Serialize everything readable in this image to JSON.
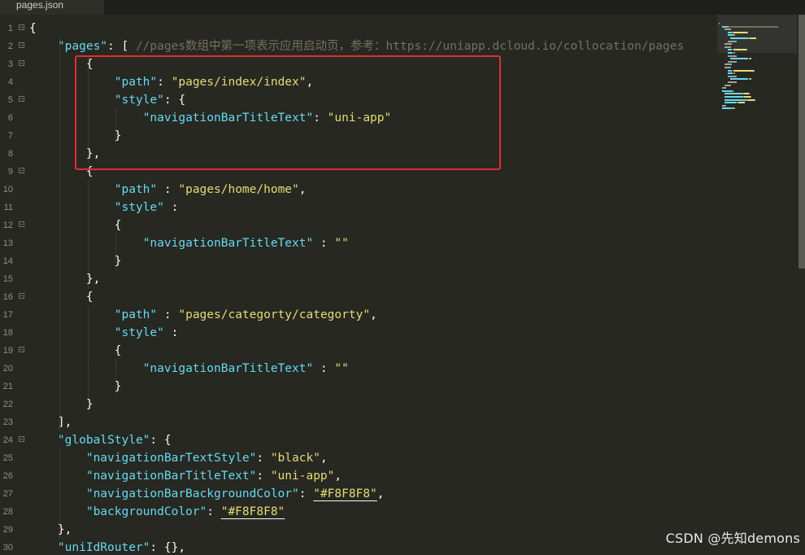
{
  "tab": {
    "filename": "pages.json"
  },
  "watermark": "CSDN @先知demons",
  "colors": {
    "background": "#272822",
    "string": "#e6db74",
    "key": "#66d9ef",
    "comment": "#75715e",
    "highlight_box": "#e0302a"
  },
  "lines": [
    {
      "n": "1",
      "fold": true,
      "tokens": [
        [
          "p",
          "{"
        ]
      ]
    },
    {
      "n": "2",
      "fold": true,
      "tokens": [
        [
          "p",
          "    "
        ],
        [
          "k",
          "\"pages\""
        ],
        [
          "p",
          ": [ "
        ],
        [
          "c",
          "//pages数组中第一项表示应用启动页，参考：https://uniapp.dcloud.io/collocation/pages"
        ]
      ]
    },
    {
      "n": "3",
      "fold": true,
      "tokens": [
        [
          "p",
          "        {"
        ]
      ]
    },
    {
      "n": "4",
      "fold": false,
      "tokens": [
        [
          "p",
          "            "
        ],
        [
          "k",
          "\"path\""
        ],
        [
          "p",
          ": "
        ],
        [
          "s",
          "\"pages/index/index\""
        ],
        [
          "p",
          ","
        ]
      ]
    },
    {
      "n": "5",
      "fold": true,
      "tokens": [
        [
          "p",
          "            "
        ],
        [
          "k",
          "\"style\""
        ],
        [
          "p",
          ": {"
        ]
      ]
    },
    {
      "n": "6",
      "fold": false,
      "tokens": [
        [
          "p",
          "                "
        ],
        [
          "k",
          "\"navigationBarTitleText\""
        ],
        [
          "p",
          ": "
        ],
        [
          "s",
          "\"uni-app\""
        ]
      ]
    },
    {
      "n": "7",
      "fold": false,
      "tokens": [
        [
          "p",
          "            }"
        ]
      ]
    },
    {
      "n": "8",
      "fold": false,
      "tokens": [
        [
          "p",
          "        },"
        ]
      ]
    },
    {
      "n": "9",
      "fold": true,
      "tokens": [
        [
          "p",
          "        {"
        ]
      ]
    },
    {
      "n": "10",
      "fold": false,
      "tokens": [
        [
          "p",
          "            "
        ],
        [
          "k",
          "\"path\""
        ],
        [
          "p",
          " : "
        ],
        [
          "s",
          "\"pages/home/home\""
        ],
        [
          "p",
          ","
        ]
      ]
    },
    {
      "n": "11",
      "fold": false,
      "tokens": [
        [
          "p",
          "            "
        ],
        [
          "k",
          "\"style\""
        ],
        [
          "p",
          " :"
        ]
      ]
    },
    {
      "n": "12",
      "fold": true,
      "tokens": [
        [
          "p",
          "            {"
        ]
      ]
    },
    {
      "n": "13",
      "fold": false,
      "tokens": [
        [
          "p",
          "                "
        ],
        [
          "k",
          "\"navigationBarTitleText\""
        ],
        [
          "p",
          " : "
        ],
        [
          "s",
          "\"\""
        ]
      ]
    },
    {
      "n": "14",
      "fold": false,
      "tokens": [
        [
          "p",
          "            }"
        ]
      ]
    },
    {
      "n": "15",
      "fold": false,
      "tokens": [
        [
          "p",
          "        },"
        ]
      ]
    },
    {
      "n": "16",
      "fold": true,
      "tokens": [
        [
          "p",
          "        {"
        ]
      ]
    },
    {
      "n": "17",
      "fold": false,
      "tokens": [
        [
          "p",
          "            "
        ],
        [
          "k",
          "\"path\""
        ],
        [
          "p",
          " : "
        ],
        [
          "s",
          "\"pages/categorty/categorty\""
        ],
        [
          "p",
          ","
        ]
      ]
    },
    {
      "n": "18",
      "fold": false,
      "tokens": [
        [
          "p",
          "            "
        ],
        [
          "k",
          "\"style\""
        ],
        [
          "p",
          " :"
        ]
      ]
    },
    {
      "n": "19",
      "fold": true,
      "tokens": [
        [
          "p",
          "            {"
        ]
      ]
    },
    {
      "n": "20",
      "fold": false,
      "tokens": [
        [
          "p",
          "                "
        ],
        [
          "k",
          "\"navigationBarTitleText\""
        ],
        [
          "p",
          " : "
        ],
        [
          "s",
          "\"\""
        ]
      ]
    },
    {
      "n": "21",
      "fold": false,
      "tokens": [
        [
          "p",
          "            }"
        ]
      ]
    },
    {
      "n": "22",
      "fold": false,
      "tokens": [
        [
          "p",
          "        }"
        ]
      ]
    },
    {
      "n": "23",
      "fold": false,
      "tokens": [
        [
          "p",
          "    ],"
        ]
      ]
    },
    {
      "n": "24",
      "fold": true,
      "tokens": [
        [
          "p",
          "    "
        ],
        [
          "k",
          "\"globalStyle\""
        ],
        [
          "p",
          ": {"
        ]
      ]
    },
    {
      "n": "25",
      "fold": false,
      "tokens": [
        [
          "p",
          "        "
        ],
        [
          "k",
          "\"navigationBarTextStyle\""
        ],
        [
          "p",
          ": "
        ],
        [
          "s",
          "\"black\""
        ],
        [
          "p",
          ","
        ]
      ]
    },
    {
      "n": "26",
      "fold": false,
      "tokens": [
        [
          "p",
          "        "
        ],
        [
          "k",
          "\"navigationBarTitleText\""
        ],
        [
          "p",
          ": "
        ],
        [
          "s",
          "\"uni-app\""
        ],
        [
          "p",
          ","
        ]
      ]
    },
    {
      "n": "27",
      "fold": false,
      "tokens": [
        [
          "p",
          "        "
        ],
        [
          "k",
          "\"navigationBarBackgroundColor\""
        ],
        [
          "p",
          ": "
        ],
        [
          "su",
          "\"#F8F8F8\""
        ],
        [
          "p",
          ","
        ]
      ]
    },
    {
      "n": "28",
      "fold": false,
      "tokens": [
        [
          "p",
          "        "
        ],
        [
          "k",
          "\"backgroundColor\""
        ],
        [
          "p",
          ": "
        ],
        [
          "su",
          "\"#F8F8F8\""
        ]
      ]
    },
    {
      "n": "29",
      "fold": false,
      "tokens": [
        [
          "p",
          "    },"
        ]
      ]
    },
    {
      "n": "30",
      "fold": false,
      "tokens": [
        [
          "p",
          "    "
        ],
        [
          "k",
          "\"uniIdRouter\""
        ],
        [
          "p",
          ": {},"
        ]
      ]
    }
  ]
}
